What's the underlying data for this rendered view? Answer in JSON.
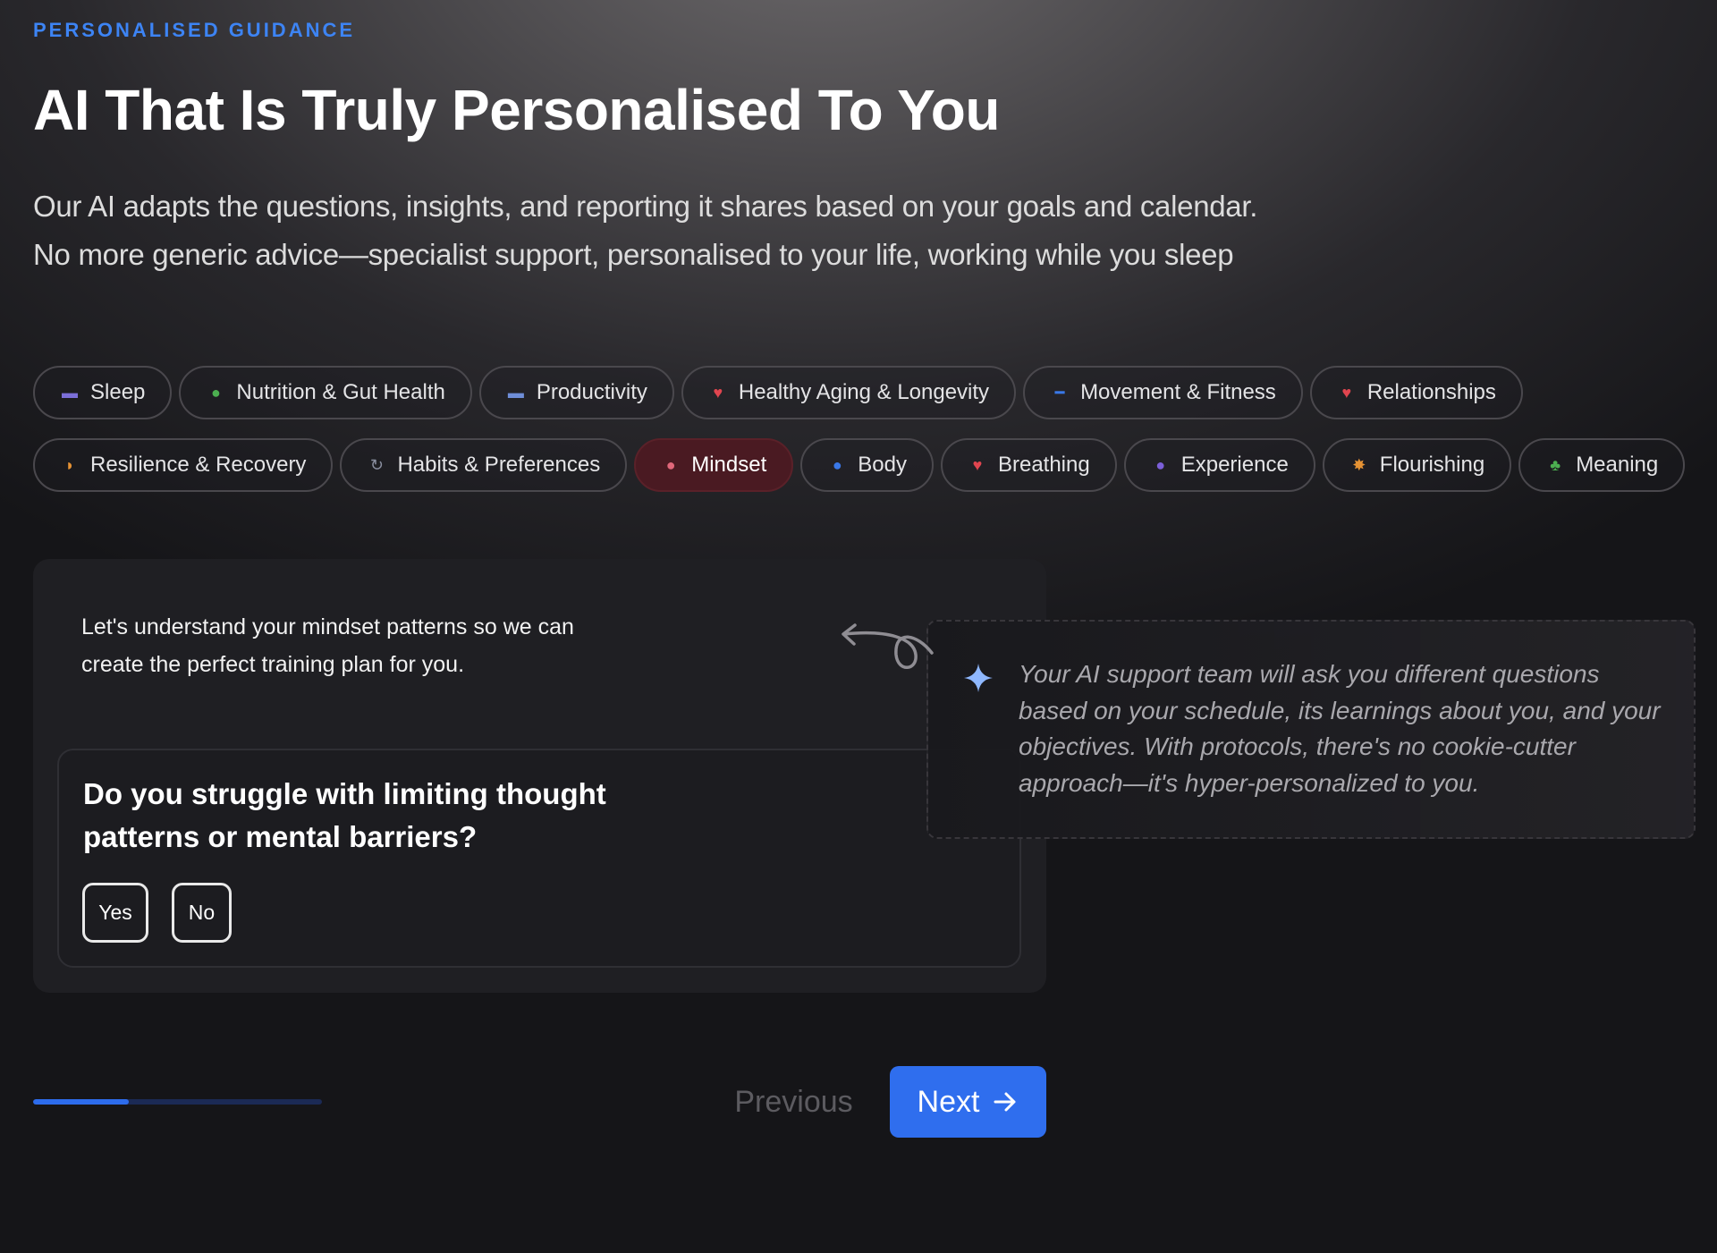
{
  "header": {
    "eyebrow": "PERSONALISED GUIDANCE",
    "title": "AI That Is Truly Personalised To You",
    "subtitle_lines": [
      "Our AI adapts the questions, insights, and reporting it shares based on your goals and calendar.",
      "No more generic advice—specialist support, personalised to your life, working while you sleep"
    ]
  },
  "categories": {
    "row1": [
      {
        "label": "Sleep",
        "icon": "bed-icon",
        "glyph": "▬",
        "color": "#7b6fd8"
      },
      {
        "label": "Nutrition & Gut Health",
        "icon": "salad-icon",
        "glyph": "●",
        "color": "#4caf50"
      },
      {
        "label": "Productivity",
        "icon": "laptop-icon",
        "glyph": "▬",
        "color": "#6f8ed8"
      },
      {
        "label": "Healthy Aging & Longevity",
        "icon": "heart-icon",
        "glyph": "♥",
        "color": "#e0454f"
      },
      {
        "label": "Movement & Fitness",
        "icon": "dumbbell-icon",
        "glyph": "━",
        "color": "#3a78e8"
      },
      {
        "label": "Relationships",
        "icon": "heart-icon",
        "glyph": "♥",
        "color": "#e0454f"
      }
    ],
    "row2": [
      {
        "label": "Resilience & Recovery",
        "icon": "flexed-arm-icon",
        "glyph": "◗",
        "color": "#e59234"
      },
      {
        "label": "Habits & Preferences",
        "icon": "refresh-icon",
        "glyph": "↻",
        "color": "#8a8fa0"
      },
      {
        "label": "Mindset",
        "icon": "brain-icon",
        "glyph": "●",
        "color": "#e0677a",
        "active": true
      },
      {
        "label": "Body",
        "icon": "person-icon",
        "glyph": "●",
        "color": "#3a78e8"
      },
      {
        "label": "Breathing",
        "icon": "heart-icon",
        "glyph": "♥",
        "color": "#e0454f"
      },
      {
        "label": "Experience",
        "icon": "crystal-ball-icon",
        "glyph": "●",
        "color": "#7b5fd8"
      },
      {
        "label": "Flourishing",
        "icon": "sparkle-star-icon",
        "glyph": "✸",
        "color": "#e59234"
      },
      {
        "label": "Meaning",
        "icon": "leaf-icon",
        "glyph": "♣",
        "color": "#4caf50"
      }
    ]
  },
  "card": {
    "intro": "Let's understand your mindset patterns so we can create the perfect training plan for you.",
    "question": "Do you struggle with limiting thought patterns or mental barriers?",
    "answers": [
      "Yes",
      "No"
    ]
  },
  "ai_note": {
    "icon": "sparkle-icon",
    "text": "Your AI support team will ask you different questions based on your schedule, its learnings about you, and your objectives. With protocols, there's no cookie-cutter approach—it's hyper-personalized to you."
  },
  "navigation": {
    "progress_percent": 33,
    "previous_label": "Previous",
    "next_label": "Next"
  },
  "colors": {
    "accent": "#2f6eee",
    "eyebrow": "#3d84f4",
    "active_chip": "#4a1a22"
  }
}
